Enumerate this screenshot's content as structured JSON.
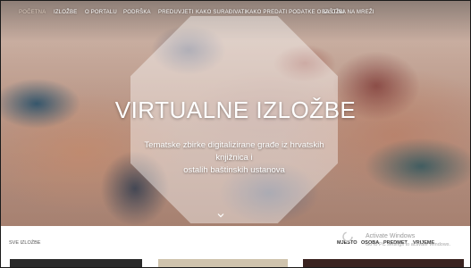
{
  "nav": {
    "items": [
      {
        "label": "Početna"
      },
      {
        "label": "Izložbe"
      },
      {
        "label": "O portalu"
      },
      {
        "label": "Podrška"
      },
      {
        "label": "Preduvjeti"
      },
      {
        "label": "Kako surađivati"
      },
      {
        "label": "Kako predati podatke o izložbi"
      },
      {
        "label": "Baština na mreži"
      }
    ]
  },
  "hero": {
    "title": "VIRTUALNE IZLOŽBE",
    "subtitle_line1": "Tematske zbirke digitalizirane građe iz hrvatskih knjižnica i",
    "subtitle_line2": "ostalih baštinskih ustanova"
  },
  "section": {
    "label": "Sve izložbe"
  },
  "filters": [
    "Mjesto",
    "Osoba",
    "Predmet",
    "Vrijeme"
  ],
  "watermark": {
    "title": "Activate Windows",
    "subtitle": "Go to PC settings to activate Windows."
  },
  "icons": {
    "scroll_down": "chevron-down-icon",
    "loading": "loading-spinner-icon"
  },
  "colors": {
    "nav_text": "#ffffff",
    "octagon_overlay": "rgba(255,255,255,0.42)"
  }
}
